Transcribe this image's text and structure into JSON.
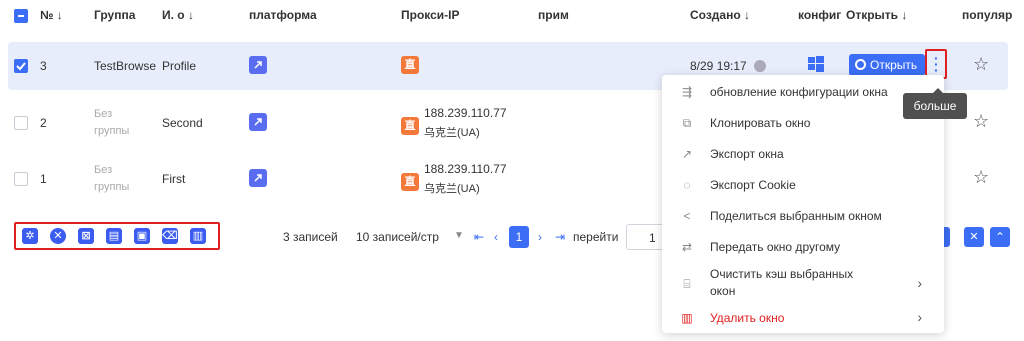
{
  "header": {
    "col_no": "№ ↓",
    "col_group": "Группа",
    "col_name": "И. о ↓",
    "col_platform": "платформа",
    "col_proxy": "Прокси-IP",
    "col_note": "прим",
    "col_created": "Создано ↓",
    "col_config": "конфиг",
    "col_open": "Открыть ↓",
    "col_popular": "популяр"
  },
  "rows": [
    {
      "no": "3",
      "group": "TestBrowse",
      "name": "Profile",
      "proxy_ip": "",
      "proxy_loc": "",
      "created": "8/29 19:17",
      "open_label": "Открыть"
    },
    {
      "no": "2",
      "group_line1": "Без",
      "group_line2": "группы",
      "name": "Second",
      "proxy_ip": "188.239.110.77",
      "proxy_loc": "乌克兰(UA)"
    },
    {
      "no": "1",
      "group_line1": "Без",
      "group_line2": "группы",
      "name": "First",
      "proxy_ip": "188.239.110.77",
      "proxy_loc": "乌克兰(UA)"
    }
  ],
  "proxy_badge": "直",
  "pagination": {
    "total": "3 записей",
    "per_page": "10 записей/стр",
    "current_page": "1",
    "goto_label": "перейти",
    "goto_value": "1"
  },
  "tooltip": "больше",
  "context_menu": [
    {
      "icon": "config-update-icon",
      "label": "обновление конфигурации окна"
    },
    {
      "icon": "clone-icon",
      "label": "Клонировать окно"
    },
    {
      "icon": "export-icon",
      "label": "Экспорт окна"
    },
    {
      "icon": "cookie-icon",
      "label": "Экспорт Cookie"
    },
    {
      "icon": "share-icon",
      "label": "Поделиться выбранным окном"
    },
    {
      "icon": "transfer-icon",
      "label": "Передать окно другому"
    },
    {
      "icon": "clear-cache-icon",
      "label_line1": "Очистить кэш выбранных",
      "label_line2": "окон"
    },
    {
      "icon": "trash-icon",
      "label": "Удалить окно"
    }
  ],
  "colors": {
    "accent": "#3b6ef5",
    "danger": "#e02020",
    "proxy": "#f4783a",
    "selected_row": "#e8edfb"
  }
}
